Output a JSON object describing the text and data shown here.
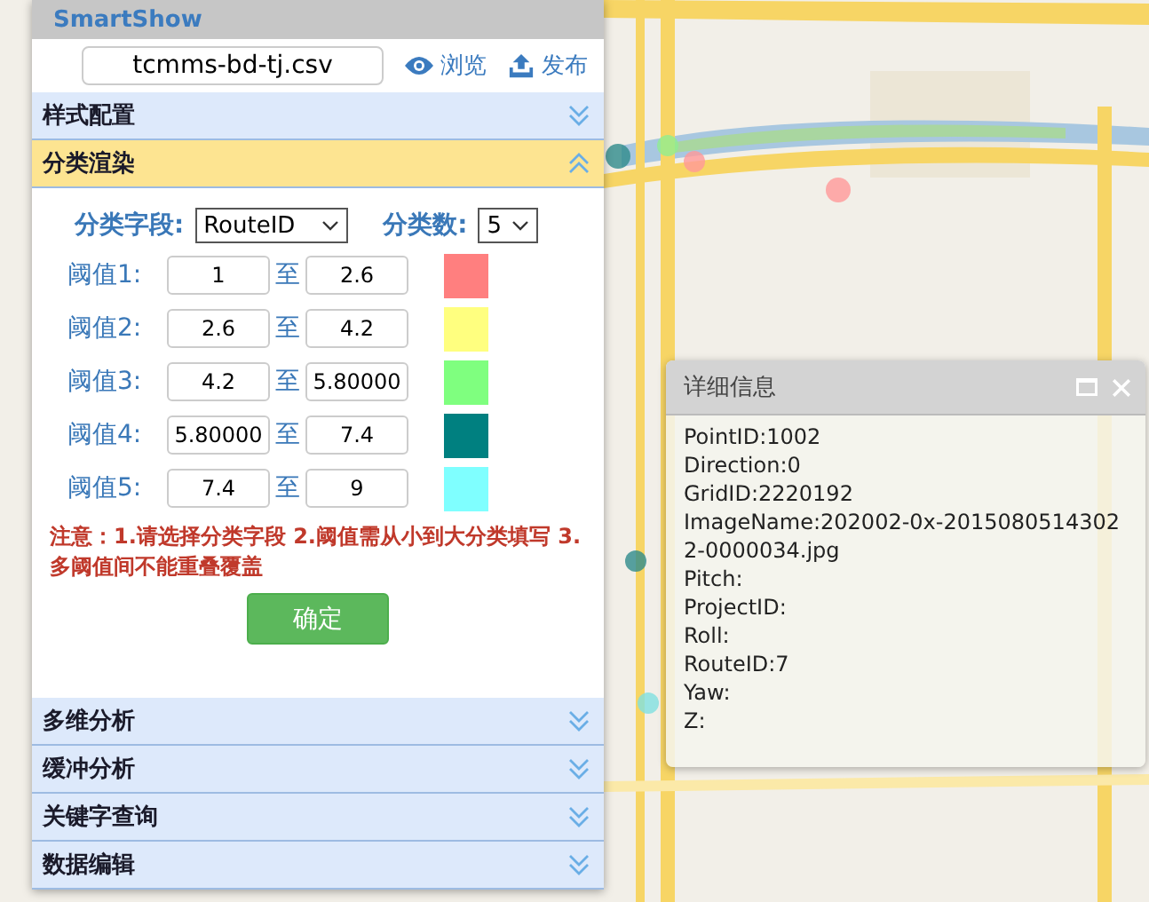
{
  "app": {
    "title": "SmartShow"
  },
  "file": {
    "value": "tcmms-bd-tj.csv",
    "actions": [
      {
        "kind": "view",
        "label": "浏览"
      },
      {
        "kind": "upload",
        "label": "发布"
      }
    ]
  },
  "sections": [
    {
      "title": "样式配置",
      "expanded": false
    },
    {
      "title": "分类渲染",
      "expanded": true
    },
    {
      "title": "多维分析",
      "expanded": false
    },
    {
      "title": "缓冲分析",
      "expanded": false
    },
    {
      "title": "关键字查询",
      "expanded": false
    },
    {
      "title": "数据编辑",
      "expanded": false
    }
  ],
  "classification": {
    "field_label": "分类字段:",
    "field_value": "RouteID",
    "count_label": "分类数:",
    "count_value": "5",
    "thresholds": [
      {
        "label": "阈值1:",
        "from": "1",
        "sep": "至",
        "to": "2.6",
        "color": "#ff7f7f"
      },
      {
        "label": "阈值2:",
        "from": "2.6",
        "sep": "至",
        "to": "4.2",
        "color": "#ffff7f"
      },
      {
        "label": "阈值3:",
        "from": "4.2",
        "sep": "至",
        "to": "5.80000",
        "color": "#7fff7f"
      },
      {
        "label": "阈值4:",
        "from": "5.80000",
        "sep": "至",
        "to": "7.4",
        "color": "#008080"
      },
      {
        "label": "阈值5:",
        "from": "7.4",
        "sep": "至",
        "to": "9",
        "color": "#7fffff"
      }
    ],
    "note": "注意：1.请选择分类字段 2.阈值需从小到大分类填写 3.多阈值间不能重叠覆盖",
    "confirm": "确定"
  },
  "popup": {
    "title": "详细信息",
    "lines": [
      "PointID:1002",
      "Direction:0",
      "GridID:2220192",
      "ImageName:202002-0x-20150805143022-0000034.jpg",
      "Pitch:",
      "ProjectID:",
      "Roll:",
      "RouteID:7",
      "Yaw:",
      "Z:"
    ]
  }
}
